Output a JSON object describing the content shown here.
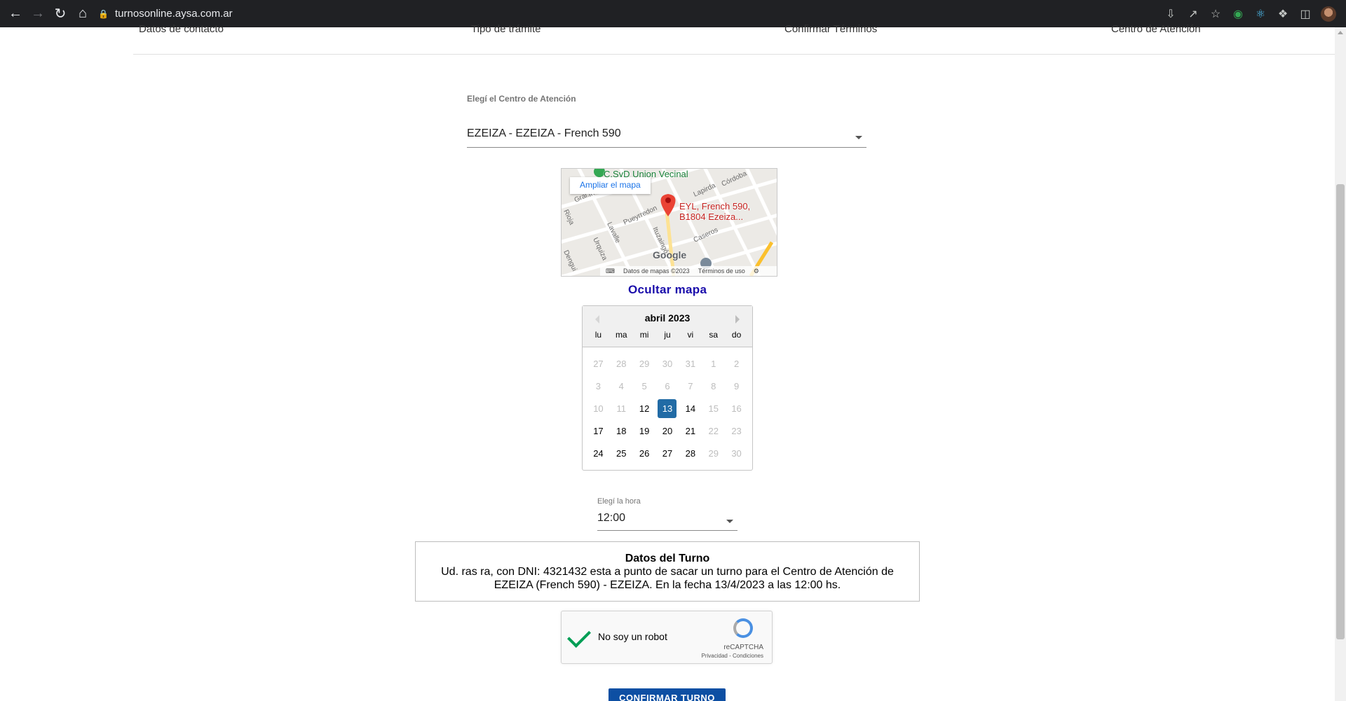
{
  "browser": {
    "url": "turnosonline.aysa.com.ar"
  },
  "steps": [
    "Datos de contacto",
    "Tipo de trámite",
    "Confirmar Términos",
    "Centro de Atención"
  ],
  "center": {
    "label": "Elegí el Centro de Atención",
    "selected": "EZEIZA - EZEIZA - French 590"
  },
  "map": {
    "enlarge_link": "Ampliar el mapa",
    "pin_line1": "EYL, French 590,",
    "pin_line2": "B1804 Ezeiza...",
    "park_label": "C.SyD Union Vecinal",
    "google": "Google",
    "data_label": "Datos de mapas ©2023",
    "terms_label": "Términos de uso",
    "toggle_label": "Ocultar mapa"
  },
  "calendar": {
    "month_label": "abril 2023",
    "weekdays": [
      "lu",
      "ma",
      "mi",
      "ju",
      "vi",
      "sa",
      "do"
    ],
    "days": [
      {
        "d": "27",
        "s": "muted"
      },
      {
        "d": "28",
        "s": "muted"
      },
      {
        "d": "29",
        "s": "muted"
      },
      {
        "d": "30",
        "s": "muted"
      },
      {
        "d": "31",
        "s": "muted"
      },
      {
        "d": "1",
        "s": "muted"
      },
      {
        "d": "2",
        "s": "muted"
      },
      {
        "d": "3",
        "s": "muted"
      },
      {
        "d": "4",
        "s": "muted"
      },
      {
        "d": "5",
        "s": "muted"
      },
      {
        "d": "6",
        "s": "muted"
      },
      {
        "d": "7",
        "s": "muted"
      },
      {
        "d": "8",
        "s": "muted"
      },
      {
        "d": "9",
        "s": "muted"
      },
      {
        "d": "10",
        "s": "muted"
      },
      {
        "d": "11",
        "s": "muted"
      },
      {
        "d": "12",
        "s": "available"
      },
      {
        "d": "13",
        "s": "selected"
      },
      {
        "d": "14",
        "s": "available"
      },
      {
        "d": "15",
        "s": "muted"
      },
      {
        "d": "16",
        "s": "muted"
      },
      {
        "d": "17",
        "s": "available"
      },
      {
        "d": "18",
        "s": "available"
      },
      {
        "d": "19",
        "s": "available"
      },
      {
        "d": "20",
        "s": "available"
      },
      {
        "d": "21",
        "s": "available"
      },
      {
        "d": "22",
        "s": "muted"
      },
      {
        "d": "23",
        "s": "muted"
      },
      {
        "d": "24",
        "s": "available"
      },
      {
        "d": "25",
        "s": "available"
      },
      {
        "d": "26",
        "s": "available"
      },
      {
        "d": "27",
        "s": "available"
      },
      {
        "d": "28",
        "s": "available"
      },
      {
        "d": "29",
        "s": "muted"
      },
      {
        "d": "30",
        "s": "muted"
      }
    ],
    "selected_color": "#216ba5"
  },
  "hour": {
    "label": "Elegí la hora",
    "selected": "12:00"
  },
  "turno": {
    "title": "Datos del Turno",
    "text": "Ud. ras ra, con DNI: 4321432 esta a punto de sacar un turno para el Centro de Atención de EZEIZA (French 590) - EZEIZA. En la fecha 13/4/2023 a las 12:00 hs."
  },
  "captcha": {
    "label": "No soy un robot",
    "brand": "reCAPTCHA",
    "links": "Privacidad - Condiciones"
  },
  "confirm_button": "CONFIRMAR TURNO"
}
